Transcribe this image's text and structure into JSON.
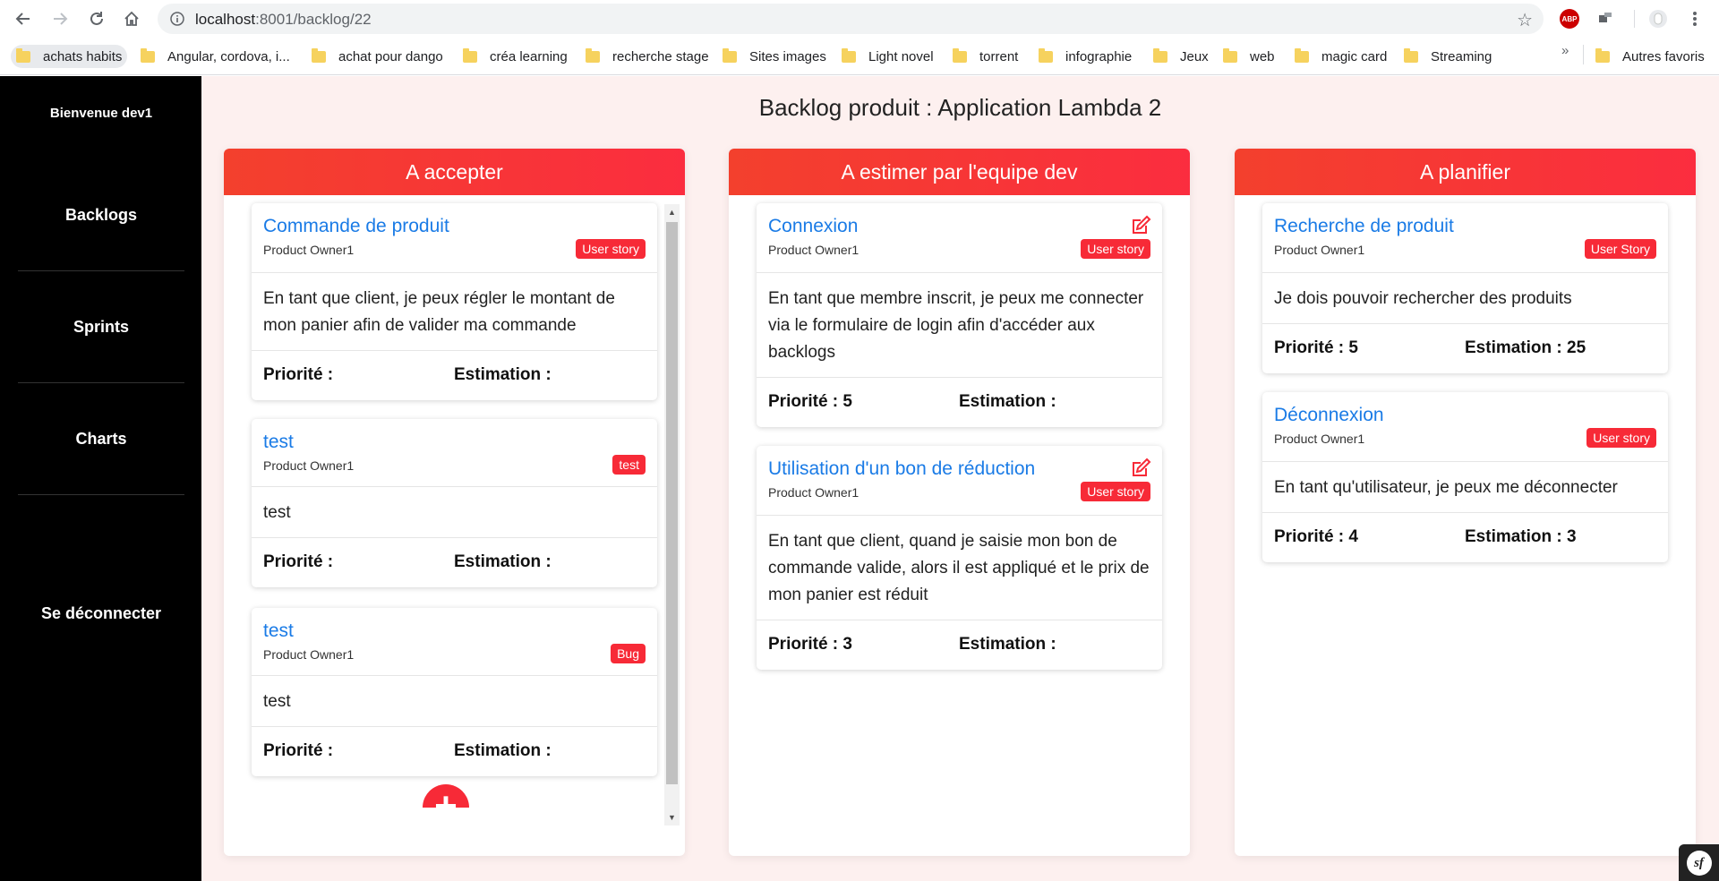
{
  "browser": {
    "url_host": "localhost",
    "url_path": ":8001/backlog/22",
    "bookmarks": [
      "achats habits",
      "Angular, cordova, i...",
      "achat pour dango",
      "créa learning",
      "recherche stage",
      "Sites images",
      "Light novel",
      "torrent",
      "infographie",
      "Jeux",
      "web",
      "magic card",
      "Streaming"
    ],
    "more_label": "»",
    "other_bookmarks": "Autres favoris",
    "abp_label": "ABP"
  },
  "sidebar": {
    "welcome": "Bienvenue dev1",
    "items": [
      "Backlogs",
      "Sprints",
      "Charts"
    ],
    "logout": "Se déconnecter"
  },
  "page": {
    "title": "Backlog produit : Application Lambda 2"
  },
  "columns": [
    {
      "title": "A accepter",
      "cards": [
        {
          "title": "Commande de produit",
          "owner": "Product Owner1",
          "badge": "User story",
          "body": "En tant que client, je peux régler le montant de mon panier afin de valider ma commande",
          "priority": "Priorité :",
          "estimation": "Estimation :"
        },
        {
          "title": "test",
          "owner": "Product Owner1",
          "badge": "test",
          "body": "test",
          "priority": "Priorité :",
          "estimation": "Estimation :"
        },
        {
          "title": "test",
          "owner": "Product Owner1",
          "badge": "Bug",
          "body": "test",
          "priority": "Priorité :",
          "estimation": "Estimation :"
        }
      ],
      "add_label": "+"
    },
    {
      "title": "A estimer par l'equipe dev",
      "cards": [
        {
          "title": "Connexion",
          "owner": "Product Owner1",
          "badge": "User story",
          "body": "En tant que membre inscrit, je peux me connecter via le formulaire de login afin d'accéder aux backlogs",
          "priority": "Priorité : 5",
          "estimation": "Estimation :"
        },
        {
          "title": "Utilisation d'un bon de réduction",
          "owner": "Product Owner1",
          "badge": "User story",
          "body": "En tant que client, quand je saisie mon bon de commande valide, alors il est appliqué et le prix de mon panier est réduit",
          "priority": "Priorité : 3",
          "estimation": "Estimation :"
        }
      ]
    },
    {
      "title": "A planifier",
      "cards": [
        {
          "title": "Recherche de produit",
          "owner": "Product Owner1",
          "badge": "User Story",
          "body": "Je dois pouvoir rechercher des produits",
          "priority": "Priorité : 5",
          "estimation": "Estimation : 25"
        },
        {
          "title": "Déconnexion",
          "owner": "Product Owner1",
          "badge": "User story",
          "body": "En tant qu'utilisateur, je peux me déconnecter",
          "priority": "Priorité : 4",
          "estimation": "Estimation : 3"
        }
      ]
    }
  ],
  "symfony_badge": "sf",
  "colors": {
    "accent": "#f72a37",
    "link": "#1a7be6",
    "sidebar": "#000000",
    "background": "#fdf0ef"
  }
}
